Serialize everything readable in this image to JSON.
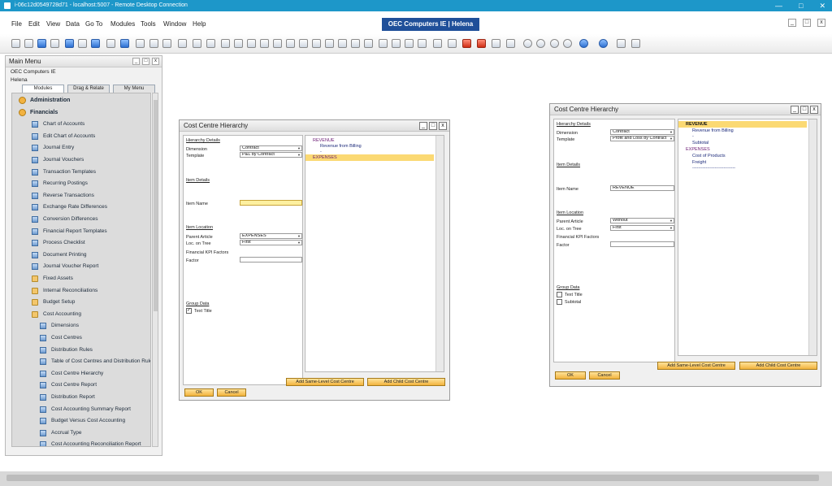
{
  "rdp": {
    "title": "i-06c12d0549728d71 - localhost:5007 - Remote Desktop Connection"
  },
  "app": {
    "title": "OEC Computers IE | Helena",
    "menu": [
      "File",
      "Edit",
      "View",
      "Data",
      "Go To",
      "Modules",
      "Tools",
      "Window",
      "Help"
    ]
  },
  "mainmenu": {
    "title": "Main Menu",
    "company": "OEC Computers IE",
    "user": "Helena",
    "tabs": [
      "Modules",
      "Drag & Relate",
      "My Menu"
    ],
    "items": [
      {
        "label": "Administration",
        "level": 0,
        "icon": "module-icon"
      },
      {
        "label": "Financials",
        "level": 0,
        "icon": "module-icon"
      },
      {
        "label": "Chart of Accounts",
        "level": 1,
        "icon": "form-icon"
      },
      {
        "label": "Edit Chart of Accounts",
        "level": 1,
        "icon": "form-icon"
      },
      {
        "label": "Journal Entry",
        "level": 1,
        "icon": "form-icon"
      },
      {
        "label": "Journal Vouchers",
        "level": 1,
        "icon": "form-icon"
      },
      {
        "label": "Transaction Templates",
        "level": 1,
        "icon": "form-icon"
      },
      {
        "label": "Recurring Postings",
        "level": 1,
        "icon": "form-icon"
      },
      {
        "label": "Reverse Transactions",
        "level": 1,
        "icon": "form-icon"
      },
      {
        "label": "Exchange Rate Differences",
        "level": 1,
        "icon": "form-icon"
      },
      {
        "label": "Conversion Differences",
        "level": 1,
        "icon": "form-icon"
      },
      {
        "label": "Financial Report Templates",
        "level": 1,
        "icon": "form-icon"
      },
      {
        "label": "Process Checklist",
        "level": 1,
        "icon": "form-icon"
      },
      {
        "label": "Document Printing",
        "level": 1,
        "icon": "form-icon"
      },
      {
        "label": "Journal Voucher Report",
        "level": 1,
        "icon": "form-icon"
      },
      {
        "label": "Fixed Assets",
        "level": 1,
        "icon": "folder-icon"
      },
      {
        "label": "Internal Reconciliations",
        "level": 1,
        "icon": "folder-icon"
      },
      {
        "label": "Budget Setup",
        "level": 1,
        "icon": "folder-icon"
      },
      {
        "label": "Cost Accounting",
        "level": 1,
        "icon": "folder-icon"
      },
      {
        "label": "Dimensions",
        "level": 2,
        "icon": "form-icon"
      },
      {
        "label": "Cost Centres",
        "level": 2,
        "icon": "form-icon"
      },
      {
        "label": "Distribution Rules",
        "level": 2,
        "icon": "form-icon"
      },
      {
        "label": "Table of Cost Centres and Distribution Rules",
        "level": 2,
        "icon": "form-icon"
      },
      {
        "label": "Cost Centre Hierarchy",
        "level": 2,
        "icon": "form-icon"
      },
      {
        "label": "Cost Centre Report",
        "level": 2,
        "icon": "form-icon"
      },
      {
        "label": "Distribution Report",
        "level": 2,
        "icon": "form-icon"
      },
      {
        "label": "Cost Accounting Summary Report",
        "level": 2,
        "icon": "form-icon"
      },
      {
        "label": "Budget Versus Cost Accounting",
        "level": 2,
        "icon": "form-icon"
      },
      {
        "label": "Accrual Type",
        "level": 2,
        "icon": "form-icon"
      },
      {
        "label": "Cost Accounting Reconciliation Report",
        "level": 2,
        "icon": "form-icon"
      }
    ]
  },
  "dlg1": {
    "title": "Cost Centre Hierarchy",
    "hierarchy_details": "Hierarchy Details",
    "dimension_label": "Dimension",
    "dimension_value": "Contract",
    "template_label": "Template",
    "template_value": "P&L by Contract",
    "item_details": "Item Details",
    "item_name_label": "Item Name",
    "item_name_value": "",
    "item_location": "Item Location",
    "parent_article_label": "Parent Article",
    "parent_article_value": "EXPENSES",
    "loc_on_tree_label": "Loc. on Tree",
    "loc_on_tree_value": "First",
    "kpi_label": "Financial KPI Factors",
    "factor_label": "Factor",
    "factor_value": "",
    "group_data": "Group Data",
    "text_title_label": "Text Title",
    "text_title_checked": true,
    "tree": {
      "revenue": "REVENUE",
      "revenue_billing": "Revenue from Billing",
      "dash": "-",
      "expenses": "EXPENSES"
    },
    "btn_same_level": "Add Same-Level Cost Centre",
    "btn_child": "Add Child Cost Centre",
    "btn_ok": "OK",
    "btn_cancel": "Cancel"
  },
  "dlg2": {
    "title": "Cost Centre Hierarchy",
    "hierarchy_details": "Hierarchy Details",
    "dimension_label": "Dimension",
    "dimension_value": "Contract",
    "template_label": "Template",
    "template_value": "Profit and Loss by Contract",
    "item_details": "Item Details",
    "item_name_label": "Item Name",
    "item_name_value": "REVENUE",
    "item_location": "Item Location",
    "parent_article_label": "Parent Article",
    "parent_article_value": "Without",
    "loc_on_tree_label": "Loc. on Tree",
    "loc_on_tree_value": "First",
    "kpi_label": "Financial KPI Factors",
    "factor_label": "Factor",
    "factor_value": "",
    "group_data": "Group Data",
    "text_title_label": "Text Title",
    "subtotal_label": "Subtotal",
    "tree": {
      "revenue": "REVENUE",
      "revenue_billing": "Revenue from Billing",
      "dash": "-",
      "subtotal": "Subtotal",
      "expenses": "EXPENSES",
      "cost_products": "Cost of Products",
      "freight": "Freight",
      "line": "-----------------------------"
    },
    "btn_same_level": "Add Same-Level Cost Centre",
    "btn_child": "Add Child Cost Centre",
    "btn_ok": "OK",
    "btn_cancel": "Cancel"
  },
  "colors": {
    "titlebar": "#1d97c9",
    "highlight": "#fbd973",
    "button": "#f2b33d",
    "app_title_bg": "#1f4f99"
  }
}
